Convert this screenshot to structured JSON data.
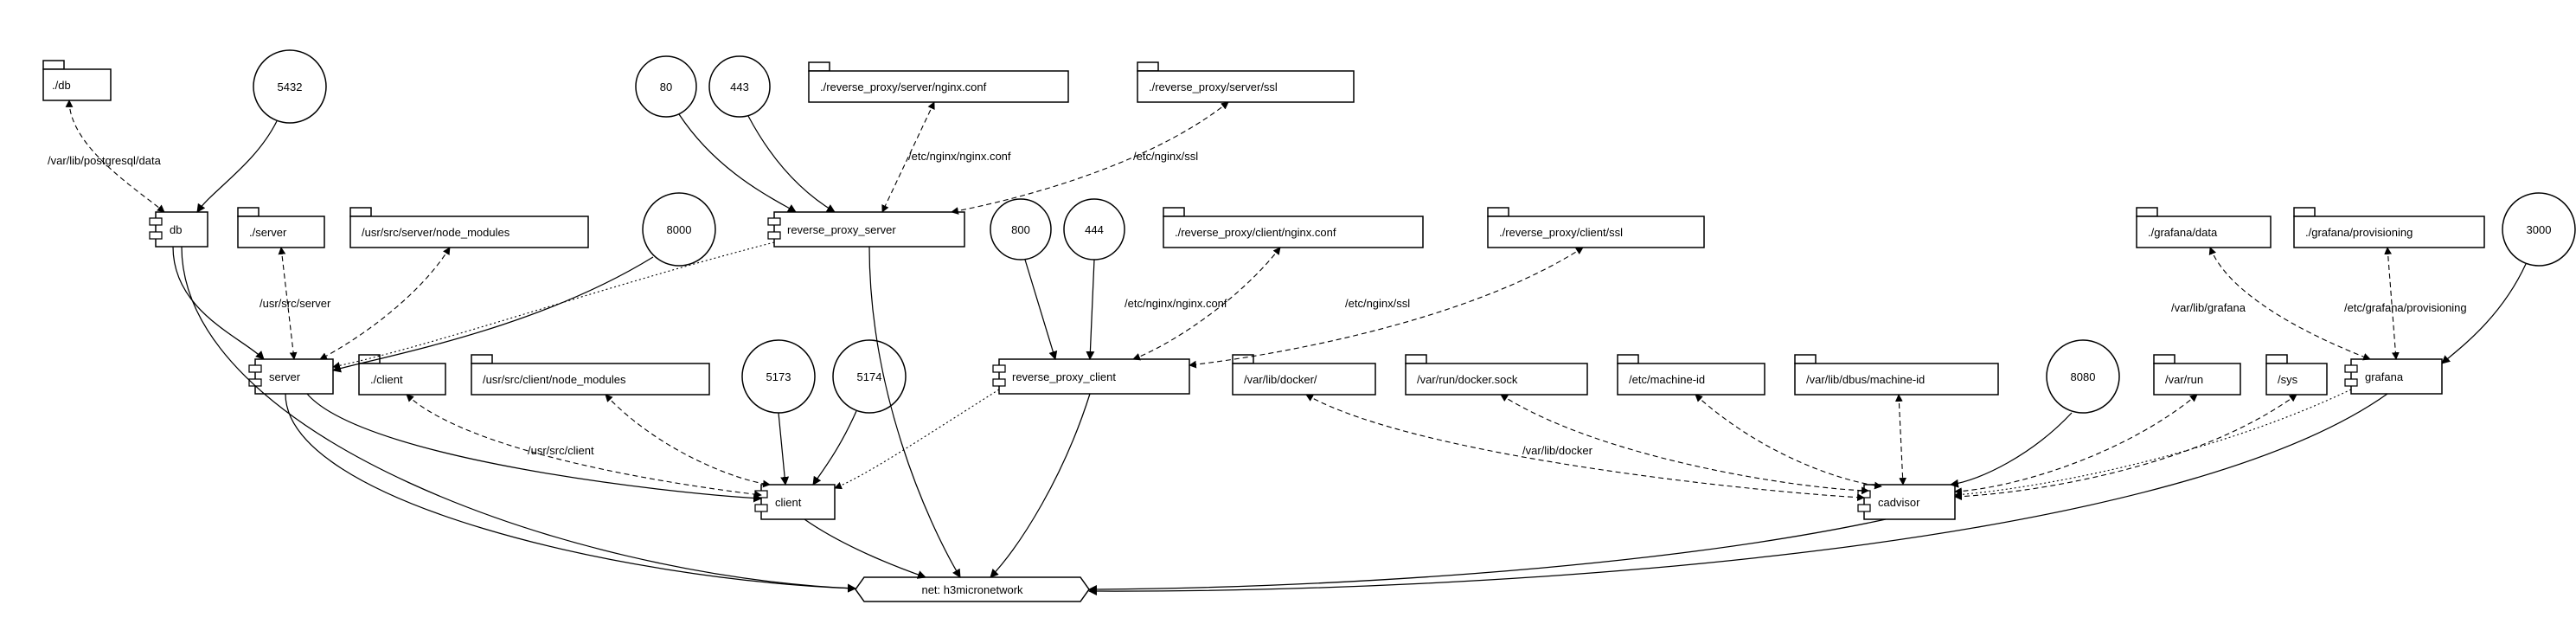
{
  "diagram": {
    "network_label": "net: h3micronetwork",
    "folders": {
      "db_vol": "./db",
      "server_vol": "./server",
      "server_node_modules": "/usr/src/server/node_modules",
      "rp_server_conf": "./reverse_proxy/server/nginx.conf",
      "rp_server_ssl": "./reverse_proxy/server/ssl",
      "client_vol": "./client",
      "client_node_modules": "/usr/src/client/node_modules",
      "rp_client_conf": "./reverse_proxy/client/nginx.conf",
      "rp_client_ssl": "./reverse_proxy/client/ssl",
      "var_lib_docker": "/var/lib/docker/",
      "var_run_docker_sock": "/var/run/docker.sock",
      "etc_machine_id": "/etc/machine-id",
      "var_lib_dbus_machine_id": "/var/lib/dbus/machine-id",
      "var_run": "/var/run",
      "sys": "/sys",
      "grafana_data": "./grafana/data",
      "grafana_provisioning": "./grafana/provisioning"
    },
    "ports": {
      "p5432": "5432",
      "p80": "80",
      "p443": "443",
      "p8000": "8000",
      "p800": "800",
      "p444": "444",
      "p5173": "5173",
      "p5174": "5174",
      "p8080": "8080",
      "p3000": "3000"
    },
    "components": {
      "db": "db",
      "reverse_proxy_server": "reverse_proxy_server",
      "server": "server",
      "reverse_proxy_client": "reverse_proxy_client",
      "client": "client",
      "cadvisor": "cadvisor",
      "grafana": "grafana"
    },
    "edge_labels": {
      "db_mount": "/var/lib/postgresql/data",
      "server_src": "/usr/src/server",
      "client_src": "/usr/src/client",
      "nginx_conf": "/etc/nginx/nginx.conf",
      "nginx_ssl": "/etc/nginx/ssl",
      "var_lib_docker_lbl": "/var/lib/docker",
      "grafana_lib": "/var/lib/grafana",
      "grafana_prov": "/etc/grafana/provisioning"
    }
  }
}
